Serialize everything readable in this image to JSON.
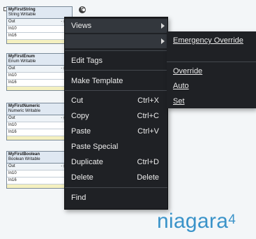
{
  "components": [
    {
      "title": "MyFirstString",
      "subtitle": "String Writable",
      "rows": [
        {
          "name": "Out",
          "value": "- {nul"
        },
        {
          "name": "In10",
          "value": ""
        },
        {
          "name": "In16",
          "value": ""
        }
      ]
    },
    {
      "title": "MyFirstEnum",
      "subtitle": "Enum Writable",
      "rows": [
        {
          "name": "Out",
          "value": "- {nul"
        },
        {
          "name": "In10",
          "value": ""
        },
        {
          "name": "In16",
          "value": ""
        }
      ]
    },
    {
      "title": "MyFirstNumeric",
      "subtitle": "Numeric Writable",
      "rows": [
        {
          "name": "Out",
          "value": "- {nul"
        },
        {
          "name": "In10",
          "value": ""
        },
        {
          "name": "In16",
          "value": ""
        }
      ]
    },
    {
      "title": "MyFirstBoolean",
      "subtitle": "Boolean Writable",
      "rows": [
        {
          "name": "Out",
          "value": "- {nul"
        },
        {
          "name": "In10",
          "value": ""
        },
        {
          "name": "In16",
          "value": ""
        }
      ]
    }
  ],
  "mini_badge": "S",
  "menu": {
    "views": "Views",
    "edit_tags": "Edit Tags",
    "make_template": "Make Template",
    "cut": "Cut",
    "cut_sc": "Ctrl+X",
    "copy": "Copy",
    "copy_sc": "Ctrl+C",
    "paste": "Paste",
    "paste_sc": "Ctrl+V",
    "paste_special": "Paste Special",
    "duplicate": "Duplicate",
    "duplicate_sc": "Ctrl+D",
    "delete": "Delete",
    "delete_sc": "Delete",
    "find": "Find"
  },
  "submenu": {
    "emergency_override": "Emergency Override",
    "override": "Override",
    "auto": "Auto",
    "set": "Set"
  },
  "logo": {
    "text": "niagara",
    "version": "4"
  },
  "colors": {
    "menu_bg": "#1f2125",
    "logo_blue": "#3a93c9"
  }
}
